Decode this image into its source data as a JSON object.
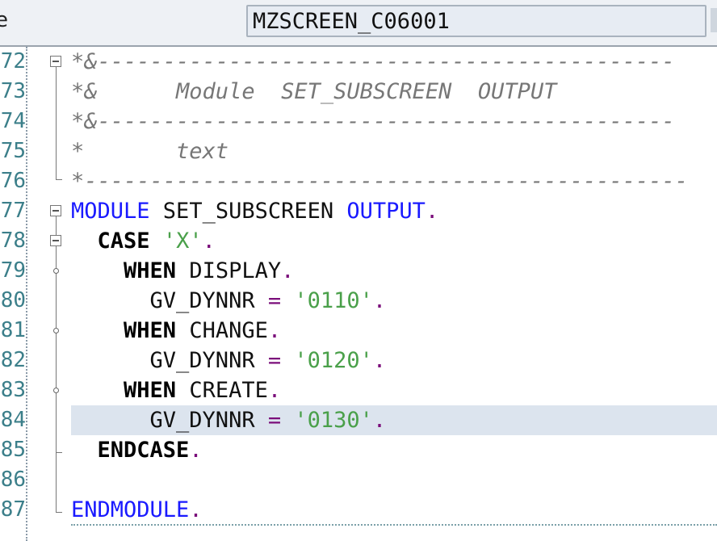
{
  "header": {
    "left_label": "e",
    "program_name": "MZSCREEN_C06001"
  },
  "lines": [
    {
      "no": "72",
      "segments": [
        {
          "t": "*&",
          "c": "comment"
        },
        {
          "t": "--------------------------------------------",
          "c": "comment"
        }
      ]
    },
    {
      "no": "73",
      "segments": [
        {
          "t": "*&      Module  SET_SUBSCREEN  OUTPUT",
          "c": "comment"
        }
      ]
    },
    {
      "no": "74",
      "segments": [
        {
          "t": "*&",
          "c": "comment"
        },
        {
          "t": "--------------------------------------------",
          "c": "comment"
        }
      ]
    },
    {
      "no": "75",
      "segments": [
        {
          "t": "*       text",
          "c": "comment"
        }
      ]
    },
    {
      "no": "76",
      "segments": [
        {
          "t": "*----------------------------------------------",
          "c": "comment"
        }
      ]
    },
    {
      "no": "77",
      "segments": [
        {
          "t": "MODULE",
          "c": "kw-blue"
        },
        {
          "t": " SET_SUBSCREEN ",
          "c": ""
        },
        {
          "t": "OUTPUT",
          "c": "kw-blue"
        },
        {
          "t": ".",
          "c": "punct"
        }
      ]
    },
    {
      "no": "78",
      "segments": [
        {
          "t": "  ",
          "c": ""
        },
        {
          "t": "CASE",
          "c": "kw-bold"
        },
        {
          "t": " ",
          "c": ""
        },
        {
          "t": "'X'",
          "c": "str"
        },
        {
          "t": ".",
          "c": "punct"
        }
      ]
    },
    {
      "no": "79",
      "segments": [
        {
          "t": "    ",
          "c": ""
        },
        {
          "t": "WHEN",
          "c": "kw-bold"
        },
        {
          "t": " DISPLAY",
          "c": ""
        },
        {
          "t": ".",
          "c": "punct"
        }
      ]
    },
    {
      "no": "80",
      "segments": [
        {
          "t": "      GV_DYNNR ",
          "c": ""
        },
        {
          "t": "=",
          "c": "punct"
        },
        {
          "t": " ",
          "c": ""
        },
        {
          "t": "'0110'",
          "c": "str"
        },
        {
          "t": ".",
          "c": "punct"
        }
      ]
    },
    {
      "no": "81",
      "segments": [
        {
          "t": "    ",
          "c": ""
        },
        {
          "t": "WHEN",
          "c": "kw-bold"
        },
        {
          "t": " CHANGE",
          "c": ""
        },
        {
          "t": ".",
          "c": "punct"
        }
      ]
    },
    {
      "no": "82",
      "segments": [
        {
          "t": "      GV_DYNNR ",
          "c": ""
        },
        {
          "t": "=",
          "c": "punct"
        },
        {
          "t": " ",
          "c": ""
        },
        {
          "t": "'0120'",
          "c": "str"
        },
        {
          "t": ".",
          "c": "punct"
        }
      ]
    },
    {
      "no": "83",
      "segments": [
        {
          "t": "    ",
          "c": ""
        },
        {
          "t": "WHEN",
          "c": "kw-bold"
        },
        {
          "t": " CREATE",
          "c": ""
        },
        {
          "t": ".",
          "c": "punct"
        }
      ]
    },
    {
      "no": "84",
      "highlight": true,
      "segments": [
        {
          "t": "      GV_DYNNR ",
          "c": ""
        },
        {
          "t": "=",
          "c": "punct"
        },
        {
          "t": " ",
          "c": ""
        },
        {
          "t": "'0130'",
          "c": "str"
        },
        {
          "t": ".",
          "c": "punct"
        }
      ]
    },
    {
      "no": "85",
      "segments": [
        {
          "t": "  ",
          "c": ""
        },
        {
          "t": "ENDCASE",
          "c": "kw-bold"
        },
        {
          "t": ".",
          "c": "punct"
        }
      ]
    },
    {
      "no": "86",
      "segments": []
    },
    {
      "no": "87",
      "segments": [
        {
          "t": "ENDMODULE",
          "c": "kw-blue"
        },
        {
          "t": ".",
          "c": "punct"
        }
      ]
    }
  ]
}
